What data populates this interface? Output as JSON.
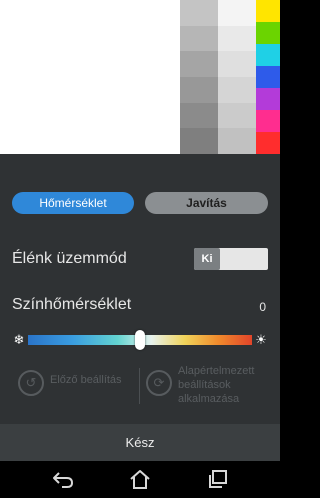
{
  "tabs": {
    "temperature": "Hőmérséklet",
    "fix": "Javítás"
  },
  "vivid_mode": {
    "label": "Élénk üzemmód",
    "switch_text": "Ki"
  },
  "color_temperature": {
    "label": "Színhőmérséklet",
    "value": "0",
    "slider_position": 0.5
  },
  "actions": {
    "previous": "Előző beállítás",
    "defaults": "Alapértelmezett beállítások alkalmazása"
  },
  "done_button": "Kész",
  "palette": {
    "col1": [
      "#c4c4c4",
      "#b6b6b6",
      "#a5a5a5",
      "#989898",
      "#8b8b8b",
      "#7f7f7f"
    ],
    "col2": [
      "#f4f4f4",
      "#e9e9e9",
      "#dfdfdf",
      "#d5d5d5",
      "#cbcbcb",
      "#c1c1c1"
    ],
    "col3": [
      "#ffe500",
      "#6bd400",
      "#1fd0e6",
      "#2e5bea",
      "#b33bd9",
      "#ff2d8f",
      "#ff2d2d"
    ]
  },
  "icons": {
    "cold": "snowflake-icon",
    "warm": "sun-icon",
    "previous": "undo-circle-icon",
    "defaults": "reset-circle-icon",
    "back": "back-icon",
    "home": "home-icon",
    "recent": "recent-apps-icon"
  }
}
